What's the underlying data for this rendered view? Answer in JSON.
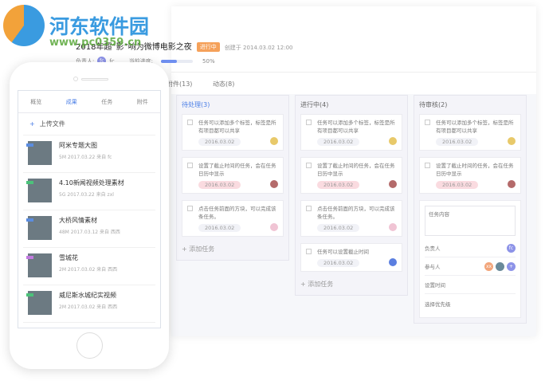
{
  "watermark": {
    "name": "河东软件园",
    "url": "www.pc0359.cn"
  },
  "project": {
    "title": "2018年超“影”响为微博电影之夜",
    "status": "进行中",
    "created": "创建于 2014.03.02 12:00",
    "owner_label": "负责人:",
    "owner": "fc",
    "progress_label": "当前进度:",
    "progress_percent": 50,
    "progress_text": "50%"
  },
  "tabs": [
    "附件(13)",
    "动态(8)"
  ],
  "columns": [
    {
      "title": "待处理(3)",
      "cards": [
        {
          "text": "任务可以添加多个标签，标签是所有项目都可以共享",
          "date": "2016.03.02",
          "overdue": false,
          "color": "#e8c96a"
        },
        {
          "text": "设置了截止时间的任务，会在任务日历中显示",
          "date": "2016.03.02",
          "overdue": true,
          "color": "#b46a6a"
        },
        {
          "text": "点击任务前面的方块，可以完成该条任务。",
          "date": "2016.03.02",
          "overdue": false,
          "color": "#f0c4d4"
        }
      ],
      "add": "添加任务"
    },
    {
      "title": "进行中(4)",
      "cards": [
        {
          "text": "任务可以添加多个标签，标签是所有项目都可以共享",
          "date": "2016.03.02",
          "overdue": false,
          "color": "#e8c96a"
        },
        {
          "text": "设置了截止时间的任务，会在任务日历中显示",
          "date": "2016.03.02",
          "overdue": true,
          "color": "#b46a6a"
        },
        {
          "text": "点击任务前面的方块，可以完成该条任务。",
          "date": "2016.03.02",
          "overdue": false,
          "color": "#f0c4d4"
        },
        {
          "text": "任务可以设置截止时间",
          "date": "2016.03.02",
          "overdue": false,
          "color": "#5b7fe0"
        }
      ],
      "add": "添加任务"
    },
    {
      "title": "待审核(2)",
      "cards": [
        {
          "text": "任务可以添加多个标签，标签是所有项目都可以共享",
          "date": "2016.03.02",
          "overdue": false,
          "color": "#e8c96a"
        },
        {
          "text": "设置了截止时间的任务，会在任务日历中显示",
          "date": "2016.03.02",
          "overdue": true,
          "color": "#b46a6a"
        }
      ]
    }
  ],
  "form": {
    "placeholder": "任务内容",
    "owner_label": "负责人",
    "owner": "fc",
    "participants_label": "参与人",
    "participant": "xx",
    "add": "+",
    "time_label": "设置时间",
    "priority_label": "选择优先级"
  },
  "phone": {
    "tabs": [
      "概览",
      "成果",
      "任务",
      "附件"
    ],
    "upload": "上传文件",
    "files": [
      {
        "name": "阿米专题大图",
        "meta": "5M  2017.03.22  来自 fc",
        "tag": "#5b8de0"
      },
      {
        "name": "4.10新闻视频处理素材",
        "meta": "5G  2017.03.22  来自 zxl",
        "tag": "#4cc27a"
      },
      {
        "name": "大桥风情素材",
        "meta": "48M  2017.03.12  来自 西西",
        "tag": "#5b8de0"
      },
      {
        "name": "雪城花",
        "meta": "2M  2017.03.02  来自 西西",
        "tag": "#c27ae0"
      },
      {
        "name": "威尼斯水城纪实视频",
        "meta": "2M  2017.03.02  来自 西西",
        "tag": "#4cc27a"
      }
    ]
  }
}
